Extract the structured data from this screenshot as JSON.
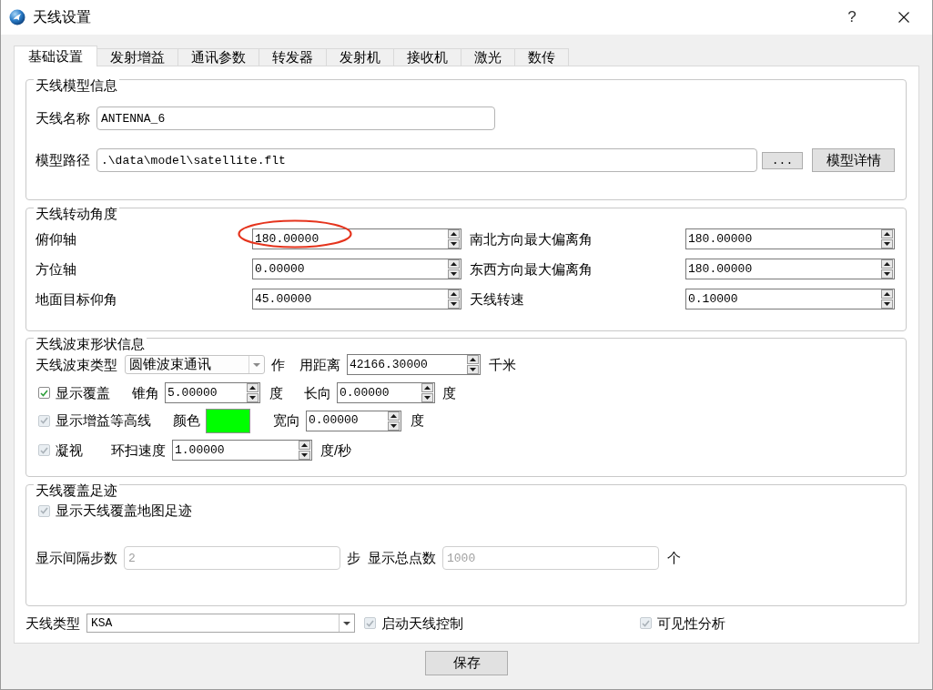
{
  "window": {
    "title": "天线设置",
    "help_button": "?"
  },
  "tabs": [
    {
      "label": "基础设置",
      "selected": true
    },
    {
      "label": "发射增益",
      "selected": false
    },
    {
      "label": "通讯参数",
      "selected": false
    },
    {
      "label": "转发器",
      "selected": false
    },
    {
      "label": "发射机",
      "selected": false
    },
    {
      "label": "接收机",
      "selected": false
    },
    {
      "label": "激光",
      "selected": false
    },
    {
      "label": "数传",
      "selected": false
    }
  ],
  "model_info": {
    "title": "天线模型信息",
    "name": {
      "label": "天线名称",
      "value": "ANTENNA_6"
    },
    "path": {
      "label": "模型路径",
      "value": ".\\data\\model\\satellite.flt",
      "browse_button": "...",
      "details_button": "模型详情"
    }
  },
  "rotation": {
    "title": "天线转动角度",
    "fields": [
      {
        "label": "俯仰轴",
        "value": "180.00000",
        "circled": true
      },
      {
        "label": "南北方向最大偏离角",
        "value": "180.00000",
        "circled": false
      },
      {
        "label": "方位轴",
        "value": "0.00000",
        "circled": false
      },
      {
        "label": "东西方向最大偏离角",
        "value": "180.00000",
        "circled": false
      },
      {
        "label": "地面目标仰角",
        "value": "45.00000",
        "circled": false
      },
      {
        "label": "天线转速",
        "value": "0.10000",
        "circled": false
      }
    ]
  },
  "beam": {
    "title": "天线波束形状信息",
    "beam_type": {
      "label": "天线波束类型",
      "value": "圆锥波束通讯"
    },
    "range": {
      "label_parts": [
        "作",
        "用距离"
      ],
      "value": "42166.30000",
      "unit": "千米"
    },
    "show_coverage": {
      "label": "显示覆盖",
      "checked": true,
      "disabled": false
    },
    "cone_angle": {
      "label": "锥角",
      "value": "5.00000",
      "unit": "度"
    },
    "length": {
      "label": "长向",
      "value": "0.00000",
      "unit": "度"
    },
    "show_gain_contour": {
      "label": "显示增益等高线",
      "checked": true,
      "disabled": true
    },
    "color": {
      "label": "颜色",
      "color": "#00ff00"
    },
    "width": {
      "label": "宽向",
      "value": "0.00000",
      "unit": "度"
    },
    "stare": {
      "label": "凝视",
      "checked": true,
      "disabled": true
    },
    "scan_speed": {
      "label": "环扫速度",
      "value": "1.00000",
      "unit": "度/秒"
    }
  },
  "footprint": {
    "title": "天线覆盖足迹",
    "show_footprint": {
      "label": "显示天线覆盖地图足迹",
      "checked": true,
      "disabled": true
    },
    "step": {
      "label": "显示间隔步数",
      "value": "2",
      "unit": "步",
      "disabled": true
    },
    "total": {
      "label": "显示总点数",
      "value": "1000",
      "unit": "个",
      "disabled": true
    }
  },
  "antenna_type": {
    "label": "天线类型",
    "value": "KSA"
  },
  "enable_control": {
    "label": "启动天线控制",
    "checked": true,
    "disabled": true
  },
  "visibility_analysis": {
    "label": "可见性分析",
    "checked": true,
    "disabled": true
  },
  "save_button": "保存"
}
